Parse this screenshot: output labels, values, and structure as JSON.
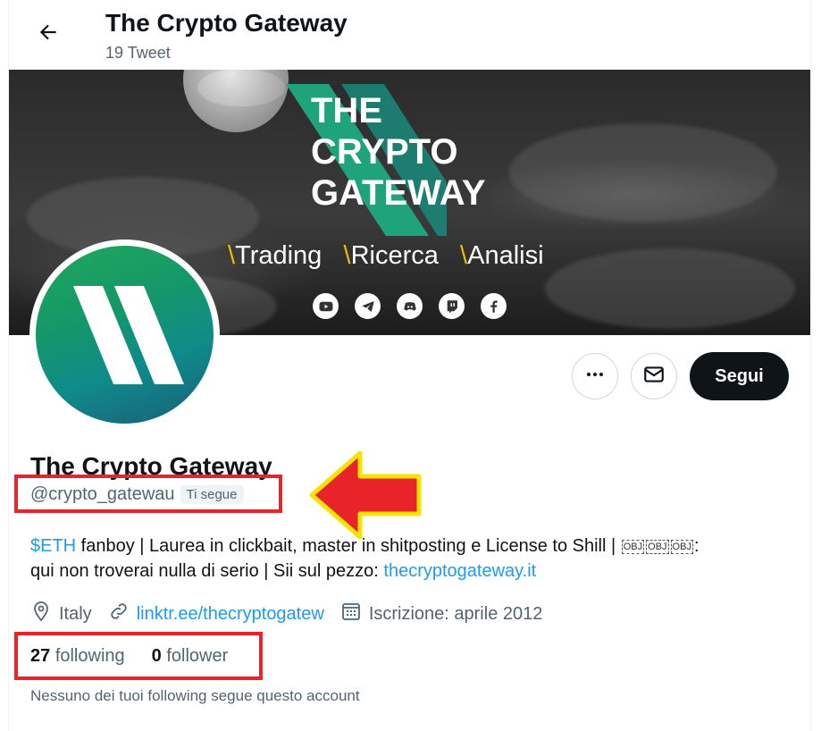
{
  "header": {
    "title": "The Crypto Gateway",
    "tweet_count": "19 Tweet",
    "back_icon": "arrow-left-icon"
  },
  "banner": {
    "brand_lines": [
      "THE",
      "CRYPTO",
      "GATEWAY"
    ],
    "tagline": [
      {
        "slash": "\\",
        "text": "Trading"
      },
      {
        "slash": "\\",
        "text": "Ricerca"
      },
      {
        "slash": "\\",
        "text": "Analisi"
      }
    ],
    "social_icons": [
      "youtube-icon",
      "telegram-icon",
      "discord-icon",
      "twitch-icon",
      "facebook-icon"
    ],
    "accent_color": "#1fa37a",
    "slash_color": "#e6c200"
  },
  "actions": {
    "more_icon": "more-icon",
    "message_icon": "mail-icon",
    "follow_label": "Segui"
  },
  "profile": {
    "name": "The Crypto Gateway",
    "handle": "@crypto_gatewau",
    "follows_you": "Ti segue",
    "bio": {
      "cashtag": "$ETH",
      "text_1": " fanboy | Laurea in clickbait, master in shitposting e License to Shill | ",
      "obj_glyphs": [
        "OBJ",
        "OBJ",
        "OBJ"
      ],
      "text_2": ":",
      "text_3": "qui non troverai nulla di serio | Sii sul pezzo: ",
      "link": "thecryptogateway.it"
    },
    "location": "Italy",
    "website": "linktr.ee/thecryptogatew",
    "joined": "Iscrizione: aprile 2012",
    "following_count": "27",
    "following_label": "following",
    "follower_count": "0",
    "follower_label": "follower",
    "notice": "Nessuno dei tuoi following segue questo account"
  },
  "annotations": {
    "highlight_color": "#e8242a",
    "arrow_fill": "#e8242a",
    "arrow_outline": "#f5e400"
  }
}
